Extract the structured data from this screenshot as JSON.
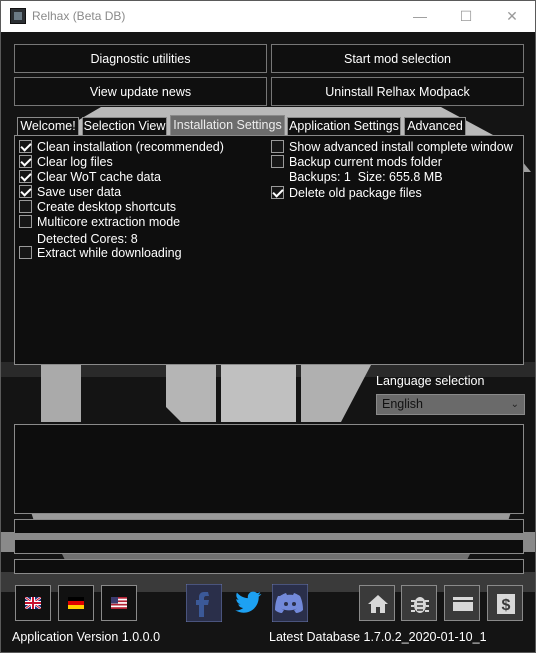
{
  "window": {
    "title": "Relhax (Beta DB)",
    "controls": {
      "minimize": "—",
      "maximize": "☐",
      "close": "✕"
    }
  },
  "buttons": {
    "diagnostic": "Diagnostic utilities",
    "start_mod_selection": "Start mod selection",
    "view_update_news": "View update news",
    "uninstall": "Uninstall Relhax Modpack"
  },
  "tabs": [
    {
      "label": "Welcome!"
    },
    {
      "label": "Selection View"
    },
    {
      "label": "Installation Settings",
      "active": true
    },
    {
      "label": "Application Settings"
    },
    {
      "label": "Advanced"
    }
  ],
  "settings": {
    "clean_installation": {
      "label": "Clean installation (recommended)",
      "checked": true
    },
    "clear_log_files": {
      "label": "Clear log files",
      "checked": true
    },
    "clear_wot_cache": {
      "label": "Clear WoT cache data",
      "checked": true
    },
    "save_user_data": {
      "label": "Save user data",
      "checked": true
    },
    "create_desktop_shortcuts": {
      "label": "Create desktop shortcuts",
      "checked": false
    },
    "multicore_extraction": {
      "label": "Multicore extraction mode",
      "checked": false
    },
    "detected_cores": "Detected Cores: 8",
    "extract_while_downloading": {
      "label": "Extract while downloading",
      "checked": false
    },
    "show_advanced_install_window": {
      "label": "Show advanced install complete window",
      "checked": false
    },
    "backup_mods_folder": {
      "label": "Backup current mods folder",
      "checked": false
    },
    "backups_info": "Backups: 1  Size: 655.8 MB",
    "delete_old_package_files": {
      "label": "Delete old package files",
      "checked": true
    }
  },
  "language": {
    "label": "Language selection",
    "selected": "English"
  },
  "flags": [
    "uk-flag-icon",
    "germany-flag-icon",
    "usa-flag-icon"
  ],
  "social": [
    "facebook-icon",
    "twitter-icon",
    "discord-icon"
  ],
  "right_icons": [
    "home-icon",
    "bug-icon",
    "mail-icon",
    "donate-icon"
  ],
  "footer": {
    "app_version": "Application Version 1.0.0.0",
    "latest_database": "Latest Database 1.7.0.2_2020-01-10_1"
  },
  "colors": {
    "background": "#141414",
    "active_tab": "#6c6c6c",
    "facebook": "#3b5998",
    "twitter": "#1da1f2",
    "discord": "#7289da"
  }
}
